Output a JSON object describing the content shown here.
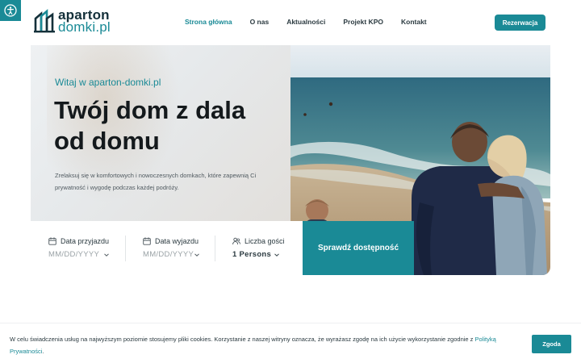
{
  "brand": {
    "line1": "aparton",
    "line2": "domki.pl",
    "accent": "#1a8a96"
  },
  "nav": {
    "items": [
      {
        "label": "Strona główna",
        "active": true
      },
      {
        "label": "O nas",
        "active": false
      },
      {
        "label": "Aktualności",
        "active": false
      },
      {
        "label": "Projekt KPO",
        "active": false
      },
      {
        "label": "Kontakt",
        "active": false
      }
    ],
    "cta_label": "Rezerwacja"
  },
  "hero": {
    "welcome": "Witaj w aparton-domki.pl",
    "headline": "Twój dom z dala od domu",
    "lead": "Zrelaksuj się w komfortowych i nowoczesnych domkach, które zapewnią Ci prywatność i wygodę podczas każdej podróży.",
    "image_alt_icon": "beach-family-photo"
  },
  "booking": {
    "checkin": {
      "label": "Data przyjazdu",
      "placeholder": "MM/DD/YYYY",
      "icon": "calendar-icon"
    },
    "checkout": {
      "label": "Data wyjazdu",
      "placeholder": "MM/DD/YYYY",
      "icon": "calendar-icon"
    },
    "guests": {
      "label": "Liczba gości",
      "value": "1  Persons",
      "icon": "users-icon"
    },
    "submit_label": "Sprawdź dostępność"
  },
  "cookie": {
    "text": "W celu świadczenia usług na najwyższym poziomie stosujemy pliki cookies. Korzystanie z naszej witryny oznacza, że wyrażasz zgodę na ich użycie wykorzystanie zgodnie z ",
    "link_label": "Polityką Prywatności",
    "end": ".",
    "agree_label": "Zgoda"
  }
}
